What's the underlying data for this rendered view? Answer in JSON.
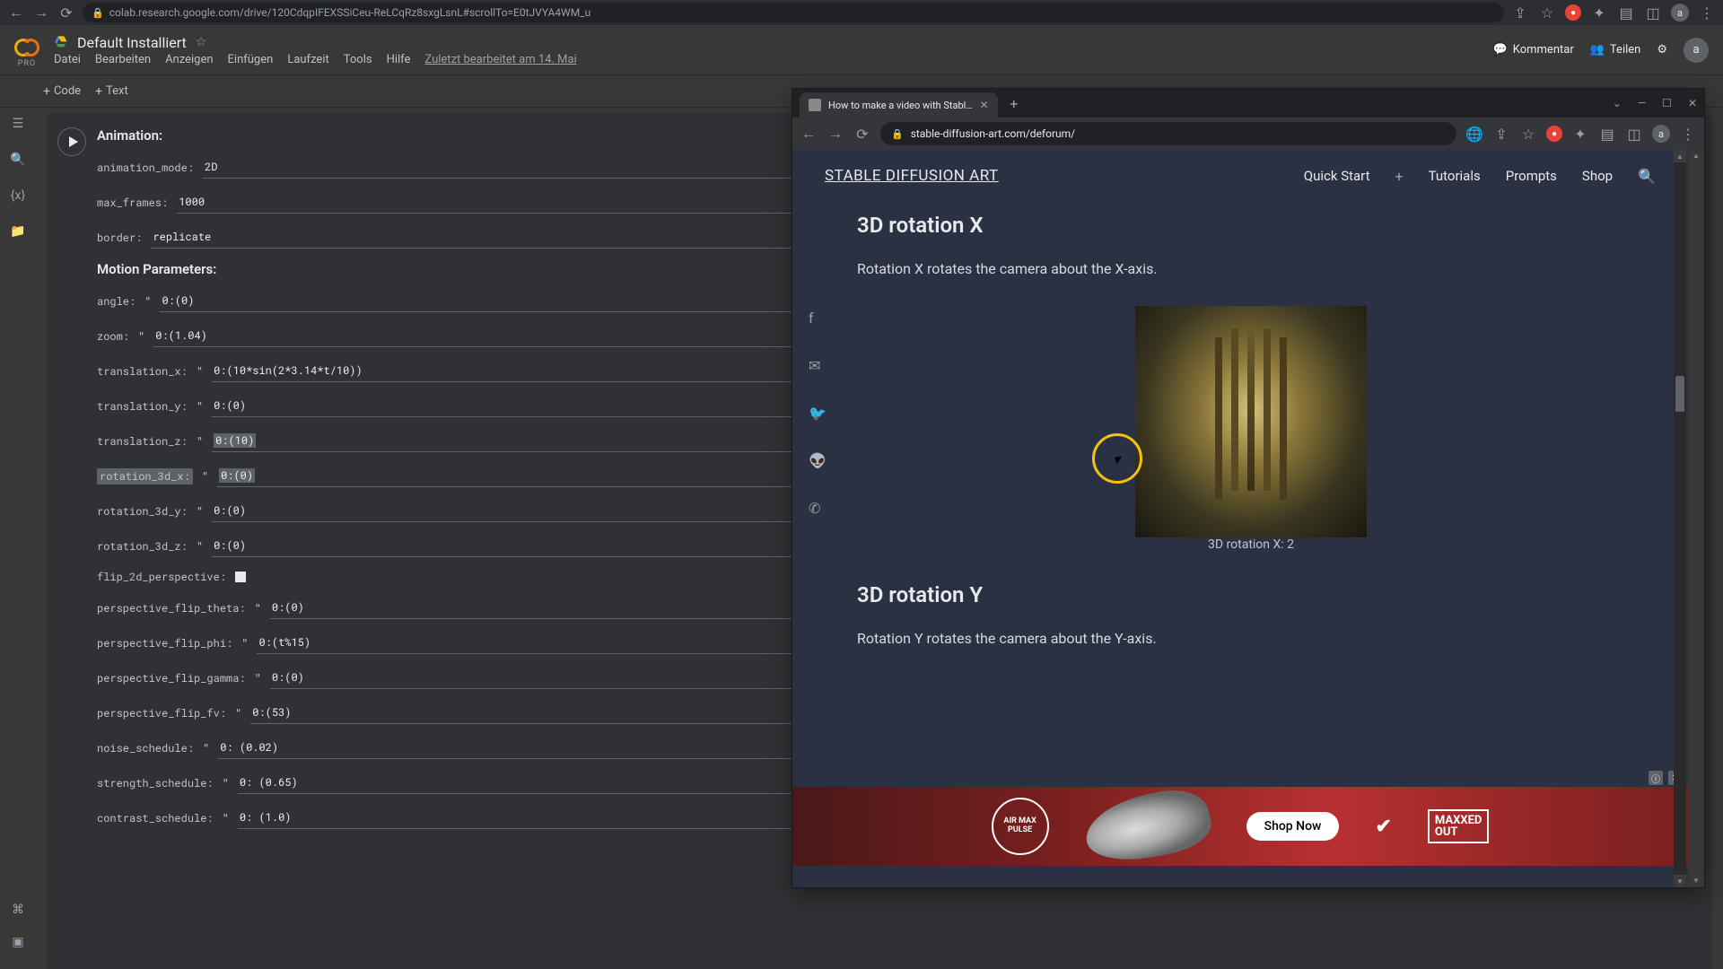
{
  "chrome": {
    "url": "colab.research.google.com/drive/120CdqpIFEXSSiCeu-ReLCqRz8sxgLsnL#scrollTo=E0tJVYA4WM_u",
    "avatar": "a"
  },
  "colab": {
    "pro": "PRO",
    "title": "Default Installiert",
    "menus": [
      "Datei",
      "Bearbeiten",
      "Anzeigen",
      "Einfügen",
      "Laufzeit",
      "Tools",
      "Hilfe"
    ],
    "edited": "Zuletzt bearbeitet am 14. Mai",
    "comment": "Kommentar",
    "share": "Teilen",
    "avatar": "a",
    "add_code": "Code",
    "add_text": "Text"
  },
  "cell": {
    "section_animation": "Animation:",
    "section_motion": "Motion Parameters:",
    "params": {
      "animation_mode": {
        "label": "animation_mode:",
        "value": "2D"
      },
      "max_frames": {
        "label": "max_frames:",
        "value": "1000"
      },
      "border": {
        "label": "border:",
        "value": "replicate"
      },
      "angle": {
        "label": "angle:",
        "value": "0:(0)"
      },
      "zoom": {
        "label": "zoom:",
        "value": "0:(1.04)"
      },
      "translation_x": {
        "label": "translation_x:",
        "value": "0:(10*sin(2*3.14*t/10))"
      },
      "translation_y": {
        "label": "translation_y:",
        "value": "0:(0)"
      },
      "translation_z": {
        "label": "translation_z:",
        "value": "0:(10)",
        "value_hl": "0:(10)",
        "label_hl": "slation_z:"
      },
      "rotation_3d_x": {
        "label": "rotation_3d_x:",
        "value": "0:(0)",
        "value_hl": "0:(0)"
      },
      "rotation_3d_y": {
        "label": "rotation_3d_y:",
        "value": "0:(0)",
        "label_hl": "rotation_3d_y"
      },
      "rotation_3d_z": {
        "label": "rotation_3d_z:",
        "value": "0:(0)"
      },
      "flip_2d_perspective": {
        "label": "flip_2d_perspective:"
      },
      "perspective_flip_theta": {
        "label": "perspective_flip_theta:",
        "value": "0:(0)"
      },
      "perspective_flip_phi": {
        "label": "perspective_flip_phi:",
        "value": "0:(t%15)"
      },
      "perspective_flip_gamma": {
        "label": "perspective_flip_gamma:",
        "value": "0:(0)"
      },
      "perspective_flip_fv": {
        "label": "perspective_flip_fv:",
        "value": "0:(53)"
      },
      "noise_schedule": {
        "label": "noise_schedule:",
        "value": "0: (0.02)"
      },
      "strength_schedule": {
        "label": "strength_schedule:",
        "value": "0: (0.65)"
      },
      "contrast_schedule": {
        "label": "contrast_schedule:",
        "value": "0: (1.0)"
      }
    }
  },
  "sub": {
    "tab_title": "How to make a video with Stabl…",
    "url": "stable-diffusion-art.com/deforum/",
    "site_name": "STABLE DIFFUSION ART",
    "nav": {
      "quick": "Quick Start",
      "tutorials": "Tutorials",
      "prompts": "Prompts",
      "shop": "Shop"
    },
    "h2_x": "3D rotation X",
    "p_x": "Rotation X rotates the camera about the X-axis.",
    "caption_x": "3D rotation X: 2",
    "h2_y": "3D rotation Y",
    "p_y": "Rotation Y rotates the camera about the Y-axis.",
    "ad": {
      "pulse1": "AIR MAX",
      "pulse2": "PULSE",
      "cta": "Shop Now",
      "brand": "✔",
      "maxxed": "MAXXED",
      "out": "OUT"
    }
  }
}
